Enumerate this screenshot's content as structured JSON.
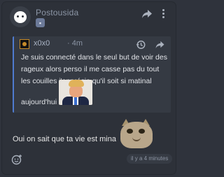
{
  "header": {
    "author": "Postousida",
    "avatar_icon": "ghost-icon",
    "role_badge_icon": "badge-icon"
  },
  "quote": {
    "author": "x0x0",
    "time": "· 4m",
    "text": "Je suis connecté dans le seul but de voir des rageux alors perso il me casse pas du tout les couilles j'apprécie qu'il soit si matinal",
    "tail": "aujourd'hui",
    "accent_color": "#4f7bd0"
  },
  "reply": {
    "text": "Oui on sait que ta vie est minable"
  },
  "footer": {
    "timestamp": "il y a 4 minutes"
  }
}
